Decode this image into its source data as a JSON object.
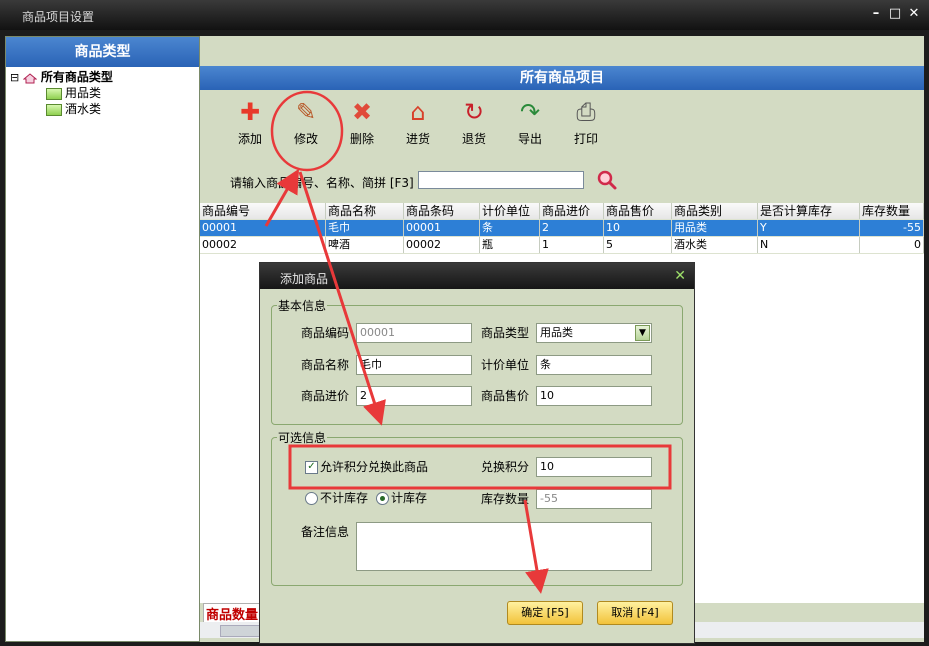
{
  "window": {
    "title": "商品项目设置",
    "btn_min": "–",
    "btn_max": "□",
    "btn_close": "✕"
  },
  "left_panel": {
    "header": "商品类型",
    "tree": [
      {
        "label": "所有商品类型",
        "expander": "⊟"
      },
      {
        "label": "用品类"
      },
      {
        "label": "酒水类"
      }
    ]
  },
  "right_panel": {
    "header": "所有商品项目",
    "toolbar": [
      {
        "label": "添加",
        "icon": "add-icon",
        "glyph": "✚",
        "color": "#e8392a"
      },
      {
        "label": "修改",
        "icon": "edit-icon",
        "glyph": "✎",
        "color": "#b85a2a"
      },
      {
        "label": "删除",
        "icon": "delete-icon",
        "glyph": "✖",
        "color": "#e04a3a"
      },
      {
        "label": "进货",
        "icon": "stock-in-icon",
        "glyph": "⌂",
        "color": "#d8402a"
      },
      {
        "label": "退货",
        "icon": "return-icon",
        "glyph": "↻",
        "color": "#c8202a"
      },
      {
        "label": "导出",
        "icon": "export-icon",
        "glyph": "↷",
        "color": "#2a8a3a"
      },
      {
        "label": "打印",
        "icon": "print-icon",
        "glyph": "⎙",
        "color": "#555555"
      }
    ],
    "search": {
      "label": "请输入商品编号、名称、简拼 [F3]",
      "value": ""
    },
    "grid": {
      "headers": [
        "商品编号",
        "商品名称",
        "商品条码",
        "计价单位",
        "商品进价",
        "商品售价",
        "商品类别",
        "是否计算库存",
        "库存数量"
      ],
      "rows": [
        [
          "00001",
          "毛巾",
          "00001",
          "条",
          "2",
          "10",
          "用品类",
          "Y",
          "-55"
        ],
        [
          "00002",
          "啤酒",
          "00002",
          "瓶",
          "1",
          "5",
          "酒水类",
          "N",
          "0"
        ]
      ],
      "selected_row": 0
    },
    "bottom_label": "商品数量"
  },
  "dialog": {
    "title": "添加商品",
    "close": "✕",
    "basic_group": "基本信息",
    "fields": {
      "code": {
        "label": "商品编码",
        "value": "00001"
      },
      "type": {
        "label": "商品类型",
        "value": "用品类"
      },
      "name": {
        "label": "商品名称",
        "value": "毛巾"
      },
      "unit": {
        "label": "计价单位",
        "value": "条"
      },
      "cost": {
        "label": "商品进价",
        "value": "2"
      },
      "price": {
        "label": "商品售价",
        "value": "10"
      }
    },
    "optional_group": "可选信息",
    "allow_points": {
      "label": "允许积分兑换此商品",
      "checked": true
    },
    "points": {
      "label": "兑换积分",
      "value": "10"
    },
    "stock_mode": {
      "no_stock": "不计库存",
      "stock": "计库存",
      "selected": "stock"
    },
    "stock_qty": {
      "label": "库存数量",
      "value": "-55"
    },
    "remark": {
      "label": "备注信息",
      "value": ""
    },
    "ok_button": "确定 [F5]",
    "cancel_button": "取消 [F4]"
  },
  "colors": {
    "accent": "#2a63b6",
    "annotation": "#e8393a",
    "panel": "#d3dbc3",
    "selection": "#2d7fd6"
  }
}
